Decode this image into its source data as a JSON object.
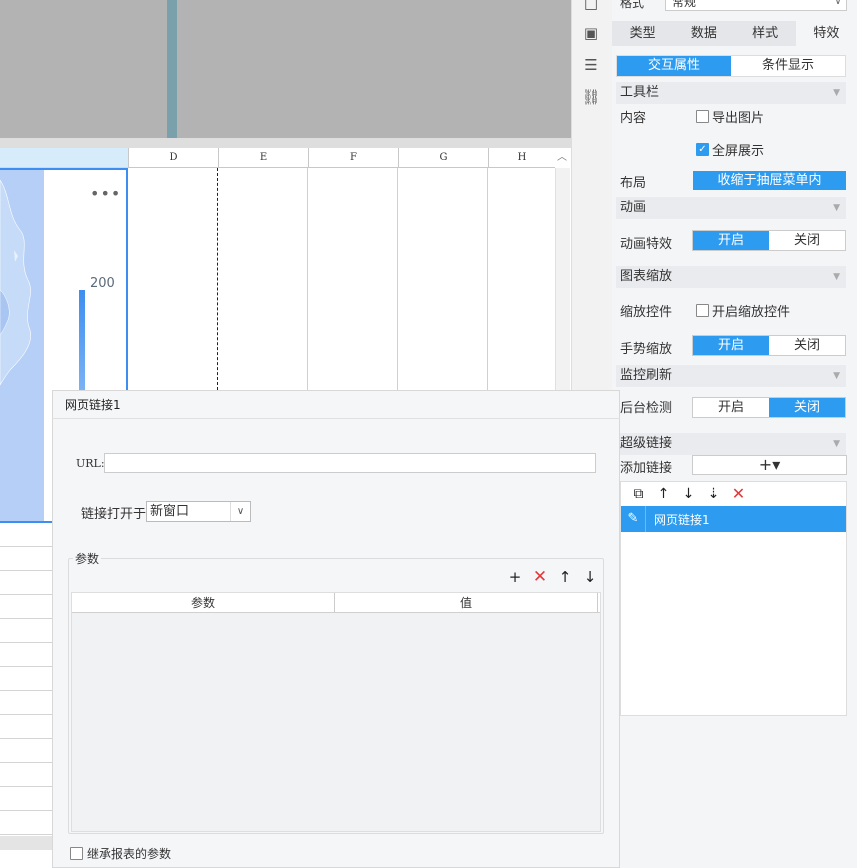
{
  "canvas": {
    "columns": [
      "D",
      "E",
      "F",
      "G",
      "H"
    ],
    "map": {
      "more": "•••",
      "legend_value": "200"
    }
  },
  "tools": {
    "icons": [
      "frame-icon",
      "dropdown-widget-icon",
      "layers-icon",
      "link-icon"
    ],
    "glyphs": [
      "□",
      "▣",
      "☰",
      "⛓"
    ]
  },
  "panel": {
    "format_label": "格式",
    "format_value": "常规",
    "main_tabs": [
      "类型",
      "数据",
      "样式",
      "特效"
    ],
    "active_main_tab": 3,
    "sub_tabs": [
      "交互属性",
      "条件显示"
    ],
    "active_sub_tab": 0,
    "toolbar": {
      "heading": "工具栏",
      "content_label": "内容",
      "export_image": "导出图片",
      "export_image_checked": false,
      "fullscreen": "全屏展示",
      "fullscreen_checked": true,
      "layout_label": "布局",
      "layout_value": "收缩于抽屉菜单内"
    },
    "animation": {
      "heading": "动画",
      "effect_label": "动画特效",
      "on": "开启",
      "off": "关闭"
    },
    "zoom": {
      "heading": "图表缩放",
      "control_label": "缩放控件",
      "enable_control": "开启缩放控件",
      "enable_control_checked": false,
      "gesture_label": "手势缩放",
      "on": "开启",
      "off": "关闭"
    },
    "refresh": {
      "heading": "监控刷新",
      "background_label": "后台检测",
      "on": "开启",
      "off": "关闭"
    },
    "hyperlink": {
      "heading": "超级链接",
      "add_label": "添加链接",
      "add_glyph": "+▾",
      "items": [
        "网页链接1"
      ]
    }
  },
  "dialog": {
    "title": "网页链接1",
    "url_label": "URL:",
    "url_value": "",
    "open_label": "链接打开于",
    "open_value": "新窗口",
    "params_label": "参数",
    "params_columns": [
      "参数",
      "值"
    ],
    "inherit_label": "继承报表的参数",
    "inherit_checked": false
  }
}
